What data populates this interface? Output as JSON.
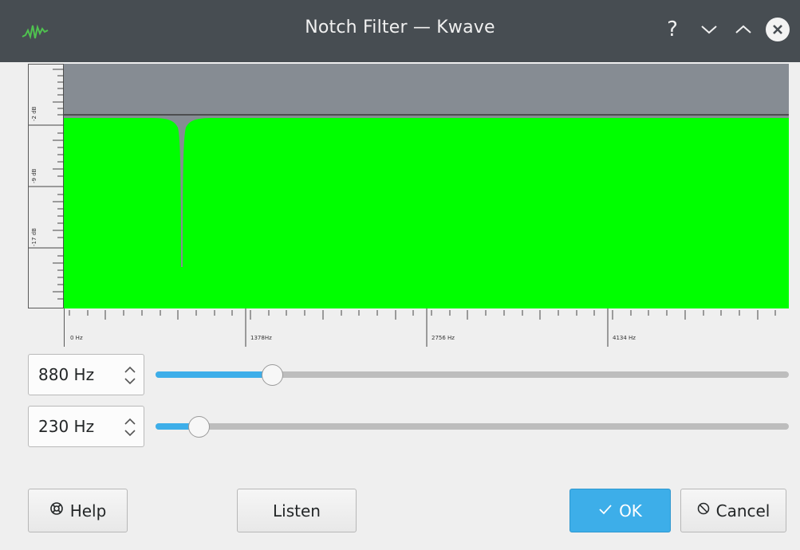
{
  "window": {
    "title": "Notch Filter — Kwave",
    "help_glyph": "?"
  },
  "graph": {
    "y_labels": [
      "-2 dB",
      "-9 dB",
      "-17 dB"
    ],
    "x_labels": [
      "0 Hz",
      "1378Hz",
      "2756 Hz",
      "4134 Hz"
    ],
    "colors": {
      "fill": "#00ff00",
      "background": "#868c93"
    }
  },
  "frequency": {
    "value": "880 Hz",
    "slider_fraction": 0.174
  },
  "bandwidth": {
    "value": "230 Hz",
    "slider_fraction": 0.053
  },
  "buttons": {
    "help": "Help",
    "listen": "Listen",
    "ok": "OK",
    "cancel": "Cancel"
  },
  "icons": {
    "app": "kwave-waveform-icon",
    "help": "lifebuoy-icon",
    "ok": "checkmark-icon",
    "cancel": "cancel-icon"
  },
  "accent_color": "#3daee9"
}
